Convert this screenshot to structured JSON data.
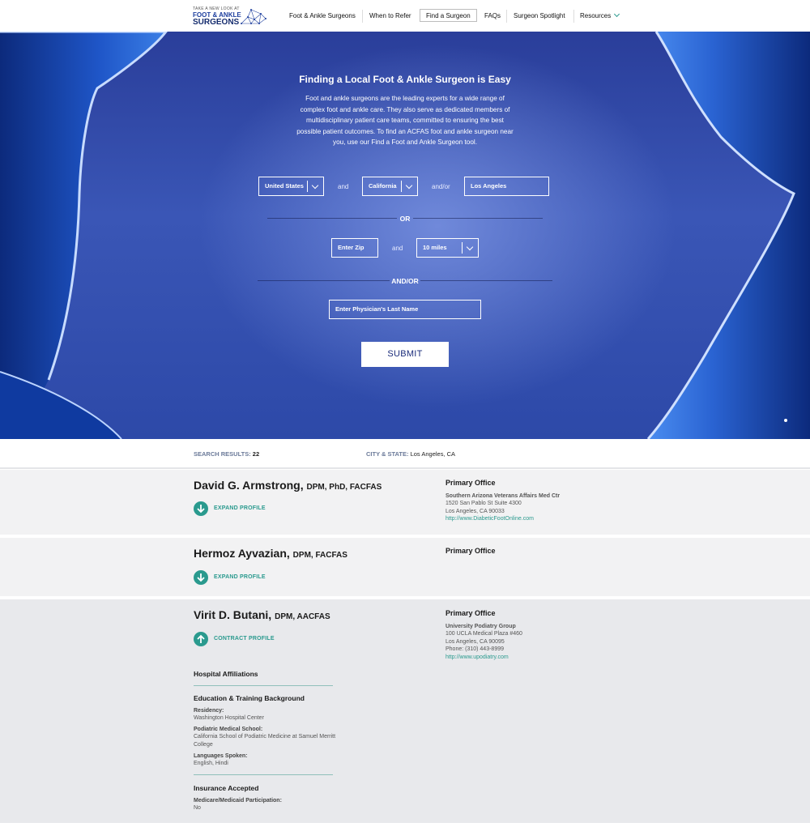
{
  "nav": {
    "logo": {
      "line1": "TAKE A NEW LOOK AT",
      "line2": "FOOT & ANKLE",
      "line3": "SURGEONS"
    },
    "items": [
      {
        "label": "Foot & Ankle Surgeons"
      },
      {
        "label": "When to Refer"
      },
      {
        "label": "Find a Surgeon"
      },
      {
        "label": "FAQs"
      },
      {
        "label": "Surgeon Spotlight"
      },
      {
        "label": "Resources"
      }
    ]
  },
  "hero": {
    "title": "Finding a Local Foot & Ankle Surgeon is Easy",
    "description": "Foot and ankle surgeons are the leading experts for a wide range of complex foot and ankle care. They also serve as dedicated members of multidisciplinary patient care teams, committed to ensuring the best possible patient outcomes. To find an ACFAS foot and ankle surgeon near you, use our Find a Foot and Ankle Surgeon tool.",
    "country": "United States",
    "and1": "and",
    "state": "California",
    "andor1": "and/or",
    "city": "Los Angeles",
    "or_label": "OR",
    "zip_placeholder": "Enter Zip",
    "and2": "and",
    "radius": "10 miles",
    "andor2": "AND/OR",
    "lastname_placeholder": "Enter Physician's Last Name",
    "submit": "SUBMIT"
  },
  "results": {
    "count_label": "SEARCH RESULTS:",
    "count": "22",
    "city_label": "CITY & STATE:",
    "city": "Los Angeles, CA"
  },
  "surgeons": [
    {
      "name": "David G. Armstrong,",
      "creds": "DPM, PhD, FACFAS",
      "toggle": "EXPAND PROFILE",
      "office_heading": "Primary Office",
      "office_name": "Southern Arizona Veterans Affairs Med Ctr",
      "address1": "1520 San Pablo St Suite 4300",
      "address2": "Los Angeles, CA 90033",
      "url": "http://www.DiabeticFootOnline.com"
    },
    {
      "name": "Hermoz Ayvazian,",
      "creds": "DPM, FACFAS",
      "toggle": "EXPAND PROFILE",
      "office_heading": "Primary Office"
    },
    {
      "name": "Virit D. Butani,",
      "creds": "DPM, AACFAS",
      "toggle": "CONTRACT PROFILE",
      "office_heading": "Primary Office",
      "office_name": "University Podiatry Group",
      "address1": "100 UCLA Medical Plaza #460",
      "address2": "Los Angeles, CA 90095",
      "phone": "Phone: (310) 443-8999",
      "url": "http://www.upodiatry.com",
      "hospital_heading": "Hospital Affiliations",
      "education_heading": "Education & Training Background",
      "residency_label": "Residency:",
      "residency": "Washington Hospital Center",
      "school_label": "Podiatric Medical School:",
      "school": "California School of Podiatric Medicine at Samuel Merritt College",
      "languages_label": "Languages Spoken:",
      "languages": "English, Hindi",
      "insurance_heading": "Insurance Accepted",
      "medicare_label": "Medicare/Medicaid Participation:",
      "medicare": "No"
    }
  ],
  "colors": {
    "teal": "#2a9a8e",
    "navy": "#1a2b7a",
    "hero": "#3a56b6"
  }
}
